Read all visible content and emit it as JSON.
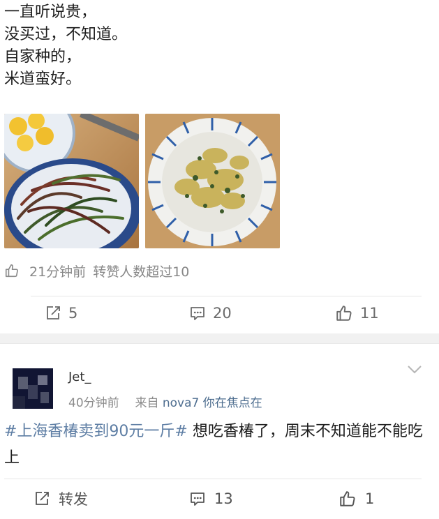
{
  "post": {
    "lines": [
      "一直听说贵，",
      "没买过，不知道。",
      "自家种的，",
      "米道蛮好。"
    ],
    "meta": {
      "time": "21分钟前",
      "forward_note": "转赞人数超过10"
    },
    "actions": {
      "repost_count": "5",
      "comment_count": "20",
      "like_count": "11"
    }
  },
  "comment": {
    "username": "Jet_",
    "time": "40分钟前",
    "source_prefix": "来自",
    "device": "nova7 你在焦点在",
    "topic": "#上海香椿卖到90元一斤#",
    "text": " 想吃香椿了，周末不知道能不能吃上",
    "actions": {
      "repost_label": "转发",
      "comment_count": "13",
      "like_count": "1"
    }
  },
  "colors": {
    "link": "#5e7ea4",
    "muted": "#888888",
    "divider": "#e6e6e6"
  },
  "icons": [
    "thumbs-up-icon",
    "share-icon",
    "comment-icon",
    "chevron-down-icon"
  ]
}
